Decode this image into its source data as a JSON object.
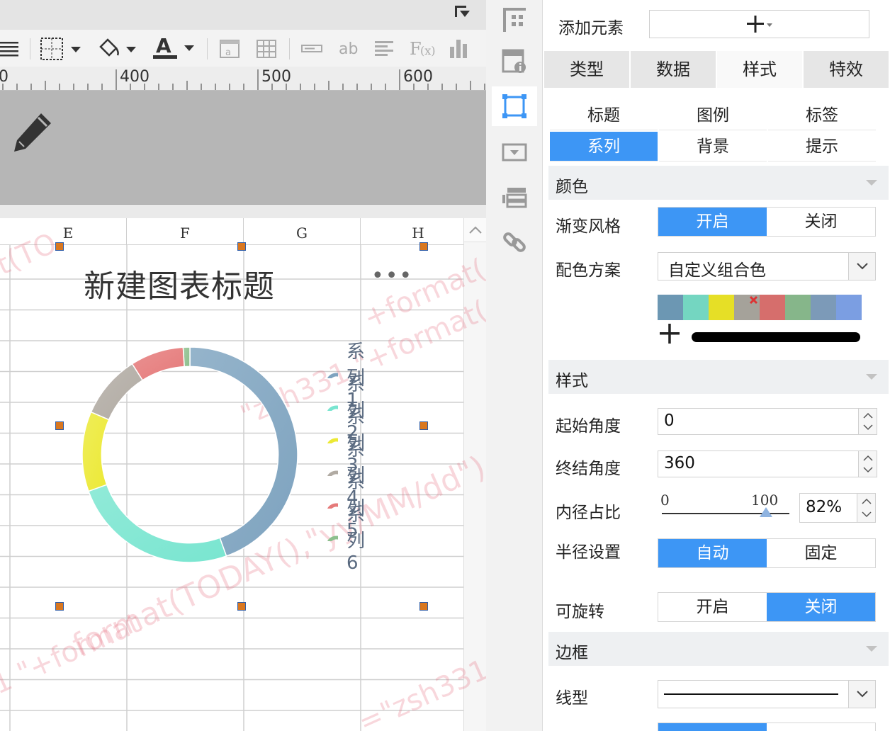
{
  "ruler": {
    "labels": [
      "0",
      "400",
      "500",
      "600"
    ]
  },
  "sheet": {
    "columns": [
      "E",
      "F",
      "G",
      "H"
    ]
  },
  "chart": {
    "title": "新建图表标题",
    "more": "•••"
  },
  "chart_data": {
    "type": "pie",
    "subtype": "donut",
    "inner_radius_ratio": 0.82,
    "start_angle": 0,
    "end_angle": 360,
    "gradient": true,
    "series": [
      {
        "name": "系列1",
        "value": 44.5,
        "color": "#7ea3bf"
      },
      {
        "name": "系列2",
        "value": 25.0,
        "color": "#79e5d0"
      },
      {
        "name": "系列3",
        "value": 12.0,
        "color": "#ece935"
      },
      {
        "name": "系列4",
        "value": 9.5,
        "color": "#b1aba3"
      },
      {
        "name": "系列5",
        "value": 8.0,
        "color": "#e57a7a"
      },
      {
        "name": "系列6",
        "value": 1.0,
        "color": "#8dbf8d"
      }
    ],
    "legend_position": "right"
  },
  "watermark": {
    "texts": [
      "t(TO",
      "+format(",
      "\"zsh331 \"+format(",
      "format(TODAY(),\"yy/MM/dd\")",
      "1 \"+format",
      "=\"zsh331"
    ]
  },
  "panel": {
    "add_element_label": "添加元素",
    "tabs": [
      "类型",
      "数据",
      "样式",
      "特效"
    ],
    "active_tab": "样式",
    "subtabs": [
      "标题",
      "图例",
      "标签",
      "系列",
      "背景",
      "提示"
    ],
    "active_subtab": "系列",
    "color_section": "颜色",
    "gradient_style_label": "渐变风格",
    "gradient_options": [
      "开启",
      "关闭"
    ],
    "gradient_value": "开启",
    "scheme_label": "配色方案",
    "scheme_value": "自定义组合色",
    "swatches": [
      "#6c97b3",
      "#74d6c1",
      "#e6df26",
      "#a5a29a",
      "#d66e6c",
      "#86b68a",
      "#7c9ab8",
      "#7b9ee2"
    ],
    "style_section": "样式",
    "start_angle_label": "起始角度",
    "start_angle": "0",
    "end_angle_label": "终结角度",
    "end_angle": "360",
    "inner_ratio_label": "内径占比",
    "slider_min": "0",
    "slider_max": "100",
    "inner_ratio": "82%",
    "radius_label": "半径设置",
    "radius_options": [
      "自动",
      "固定"
    ],
    "radius_value": "自动",
    "rotate_label": "可旋转",
    "rotate_options": [
      "开启",
      "关闭"
    ],
    "rotate_value": "关闭",
    "border_section": "边框",
    "line_type_label": "线型"
  }
}
